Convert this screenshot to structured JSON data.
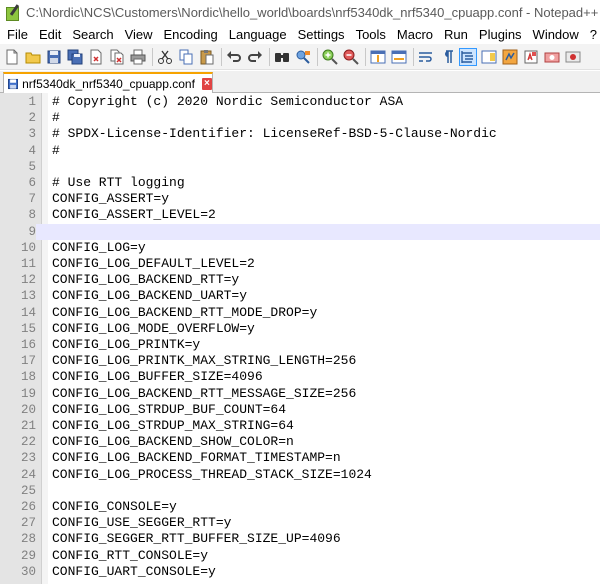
{
  "window": {
    "title": "C:\\Nordic\\NCS\\Customers\\Nordic\\hello_world\\boards\\nrf5340dk_nrf5340_cpuapp.conf - Notepad++"
  },
  "menu": [
    "File",
    "Edit",
    "Search",
    "View",
    "Encoding",
    "Language",
    "Settings",
    "Tools",
    "Macro",
    "Run",
    "Plugins",
    "Window",
    "?"
  ],
  "toolbar": {
    "icons": [
      "new-file-icon",
      "open-file-icon",
      "save-icon",
      "save-all-icon",
      "close-icon",
      "close-all-icon",
      "print-icon",
      "cut-icon",
      "copy-icon",
      "paste-icon",
      "undo-icon",
      "redo-icon",
      "find-icon",
      "replace-icon",
      "zoom-in-icon",
      "zoom-out-icon",
      "sync-vertical-icon",
      "sync-horizontal-icon",
      "word-wrap-icon",
      "show-all-chars-icon",
      "indent-guide-icon",
      "document-map-icon",
      "function-list-icon",
      "folder-workspace-icon",
      "monitoring-icon",
      "record-macro-icon"
    ]
  },
  "tab": {
    "label": "nrf5340dk_nrf5340_cpuapp.conf"
  },
  "editor": {
    "current_line": 9,
    "lines": [
      {
        "n": "1",
        "text": "# Copyright (c) 2020 Nordic Semiconductor ASA"
      },
      {
        "n": "2",
        "text": "#"
      },
      {
        "n": "3",
        "text": "# SPDX-License-Identifier: LicenseRef-BSD-5-Clause-Nordic"
      },
      {
        "n": "4",
        "text": "#"
      },
      {
        "n": "5",
        "text": ""
      },
      {
        "n": "6",
        "text": "# Use RTT logging"
      },
      {
        "n": "7",
        "text": "CONFIG_ASSERT=y"
      },
      {
        "n": "8",
        "text": "CONFIG_ASSERT_LEVEL=2"
      },
      {
        "n": "9",
        "text": ""
      },
      {
        "n": "10",
        "text": "CONFIG_LOG=y"
      },
      {
        "n": "11",
        "text": "CONFIG_LOG_DEFAULT_LEVEL=2"
      },
      {
        "n": "12",
        "text": "CONFIG_LOG_BACKEND_RTT=y"
      },
      {
        "n": "13",
        "text": "CONFIG_LOG_BACKEND_UART=y"
      },
      {
        "n": "14",
        "text": "CONFIG_LOG_BACKEND_RTT_MODE_DROP=y"
      },
      {
        "n": "15",
        "text": "CONFIG_LOG_MODE_OVERFLOW=y"
      },
      {
        "n": "16",
        "text": "CONFIG_LOG_PRINTK=y"
      },
      {
        "n": "17",
        "text": "CONFIG_LOG_PRINTK_MAX_STRING_LENGTH=256"
      },
      {
        "n": "18",
        "text": "CONFIG_LOG_BUFFER_SIZE=4096"
      },
      {
        "n": "19",
        "text": "CONFIG_LOG_BACKEND_RTT_MESSAGE_SIZE=256"
      },
      {
        "n": "20",
        "text": "CONFIG_LOG_STRDUP_BUF_COUNT=64"
      },
      {
        "n": "21",
        "text": "CONFIG_LOG_STRDUP_MAX_STRING=64"
      },
      {
        "n": "22",
        "text": "CONFIG_LOG_BACKEND_SHOW_COLOR=n"
      },
      {
        "n": "23",
        "text": "CONFIG_LOG_BACKEND_FORMAT_TIMESTAMP=n"
      },
      {
        "n": "24",
        "text": "CONFIG_LOG_PROCESS_THREAD_STACK_SIZE=1024"
      },
      {
        "n": "25",
        "text": ""
      },
      {
        "n": "26",
        "text": "CONFIG_CONSOLE=y"
      },
      {
        "n": "27",
        "text": "CONFIG_USE_SEGGER_RTT=y"
      },
      {
        "n": "28",
        "text": "CONFIG_SEGGER_RTT_BUFFER_SIZE_UP=4096"
      },
      {
        "n": "29",
        "text": "CONFIG_RTT_CONSOLE=y"
      },
      {
        "n": "30",
        "text": "CONFIG_UART_CONSOLE=y"
      }
    ]
  },
  "colors": {
    "current_line_bg": "#e8e8ff",
    "gutter_bg": "#e4e4e4",
    "tab_accent": "#f6a300",
    "line_number": "#808080"
  }
}
